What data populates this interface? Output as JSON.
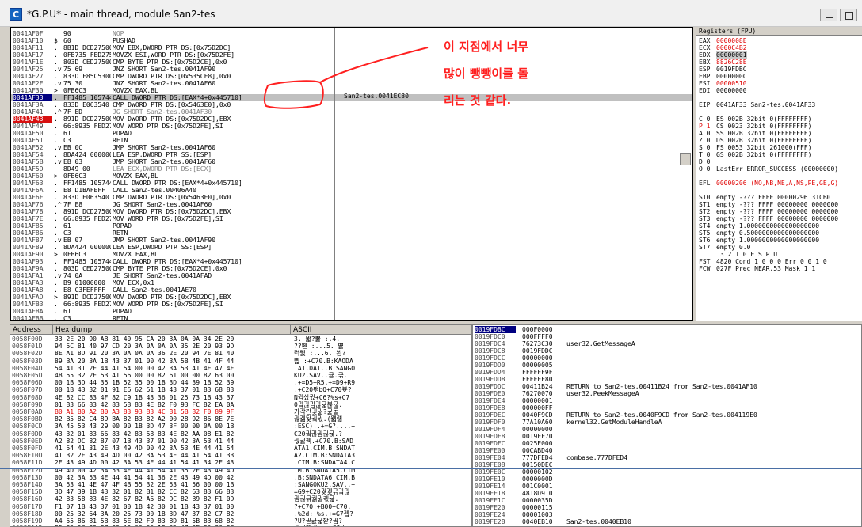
{
  "window": {
    "title": "*G.P.U* - main thread, module San2-tes",
    "app_icon_letter": "C"
  },
  "colors": {
    "annotation": "#ff2020",
    "breakpoint": "#d81010",
    "eip": "#000080",
    "selection": "#c0c0c0"
  },
  "disasm": {
    "rows": [
      {
        "addr": "0041AF0F",
        "mark": "",
        "hex": "90",
        "dis": "NOP",
        "style": "gray"
      },
      {
        "addr": "0041AF10",
        "mark": "$",
        "hex": "60",
        "dis": "PUSHAD",
        "style": ""
      },
      {
        "addr": "0041AF11",
        "mark": ".",
        "hex": "8B1D DCD27500",
        "dis": "MOV EBX,DWORD PTR DS:[0x75D2DC]",
        "style": ""
      },
      {
        "addr": "0041AF17",
        "mark": ".",
        "hex": "0FB735 FED275",
        "dis": "MOVZX ESI,WORD PTR DS:[0x75D2FE]",
        "style": ""
      },
      {
        "addr": "0041AF1E",
        "mark": ".",
        "hex": "803D CED27500",
        "dis": "CMP BYTE PTR DS:[0x75D2CE],0x0",
        "style": ""
      },
      {
        "addr": "0041AF25",
        "mark": ".v",
        "hex": "75 69",
        "dis": "JNZ SHORT San2-tes.0041AF90",
        "style": ""
      },
      {
        "addr": "0041AF27",
        "mark": ".",
        "hex": "833D F85C5300",
        "dis": "CMP DWORD PTR DS:[0x535CF8],0x0",
        "style": ""
      },
      {
        "addr": "0041AF2E",
        "mark": ".v",
        "hex": "75 30",
        "dis": "JNZ SHORT San2-tes.0041AF60",
        "style": ""
      },
      {
        "addr": "0041AF30",
        "mark": ">",
        "hex": "0FB6C3",
        "dis": "MOVZX EAX,BL",
        "style": ""
      },
      {
        "addr": "0041AF33",
        "mark": ".",
        "hex": "FF1485 105744",
        "dis": "CALL DWORD PTR DS:[EAX*4+0x445710]",
        "style": "eip sel"
      },
      {
        "addr": "0041AF3A",
        "mark": ".",
        "hex": "833D E063540",
        "dis": "CMP DWORD PTR DS:[0x5463E0],0x0",
        "style": ""
      },
      {
        "addr": "0041AF41",
        "mark": ".^",
        "hex": "7F ED",
        "dis": "JG SHORT San2-tes.0041AF30",
        "style": "gray"
      },
      {
        "addr": "0041AF43",
        "mark": ".",
        "hex": "891D DCD27500",
        "dis": "MOV DWORD PTR DS:[0x75D2DC],EBX",
        "style": "bp"
      },
      {
        "addr": "0041AF49",
        "mark": ".",
        "hex": "66:8935 FED27",
        "dis": "MOV WORD PTR DS:[0x75D2FE],SI",
        "style": ""
      },
      {
        "addr": "0041AF50",
        "mark": ".",
        "hex": "61",
        "dis": "POPAD",
        "style": ""
      },
      {
        "addr": "0041AF51",
        "mark": ".",
        "hex": "C3",
        "dis": "RETN",
        "style": ""
      },
      {
        "addr": "0041AF52",
        "mark": ".v",
        "hex": "EB 0C",
        "dis": "JMP SHORT San2-tes.0041AF60",
        "style": ""
      },
      {
        "addr": "0041AF54",
        "mark": ".",
        "hex": "8DA424 000000",
        "dis": "LEA ESP,DWORD PTR SS:[ESP]",
        "style": ""
      },
      {
        "addr": "0041AF5B",
        "mark": ".v",
        "hex": "EB 03",
        "dis": "JMP SHORT San2-tes.0041AF60",
        "style": ""
      },
      {
        "addr": "0041AF5D",
        "mark": "",
        "hex": "8D49 00",
        "dis": "LEA ECX,DWORD PTR DS:[ECX]",
        "style": "gray"
      },
      {
        "addr": "0041AF60",
        "mark": ">",
        "hex": "0FB6C3",
        "dis": "MOVZX EAX,BL",
        "style": ""
      },
      {
        "addr": "0041AF63",
        "mark": ".",
        "hex": "FF1485 105744",
        "dis": "CALL DWORD PTR DS:[EAX*4+0x445710]",
        "style": ""
      },
      {
        "addr": "0041AF6A",
        "mark": ".",
        "hex": "E8 D1BAFEFF",
        "dis": "CALL San2-tes.00406A40",
        "style": ""
      },
      {
        "addr": "0041AF6F",
        "mark": ".",
        "hex": "833D E063540",
        "dis": "CMP DWORD PTR DS:[0x5463E0],0x0",
        "style": ""
      },
      {
        "addr": "0041AF76",
        "mark": ".^",
        "hex": "7F E8",
        "dis": "JG SHORT San2-tes.0041AF60",
        "style": ""
      },
      {
        "addr": "0041AF78",
        "mark": ".",
        "hex": "891D DCD27500",
        "dis": "MOV DWORD PTR DS:[0x75D2DC],EBX",
        "style": ""
      },
      {
        "addr": "0041AF7E",
        "mark": ".",
        "hex": "66:8935 FED27",
        "dis": "MOV WORD PTR DS:[0x75D2FE],SI",
        "style": ""
      },
      {
        "addr": "0041AF85",
        "mark": ".",
        "hex": "61",
        "dis": "POPAD",
        "style": ""
      },
      {
        "addr": "0041AF86",
        "mark": ".",
        "hex": "C3",
        "dis": "RETN",
        "style": ""
      },
      {
        "addr": "0041AF87",
        "mark": ".v",
        "hex": "EB 07",
        "dis": "JMP SHORT San2-tes.0041AF90",
        "style": ""
      },
      {
        "addr": "0041AF89",
        "mark": ".",
        "hex": "8DA424 000000",
        "dis": "LEA ESP,DWORD PTR SS:[ESP]",
        "style": ""
      },
      {
        "addr": "0041AF90",
        "mark": ">",
        "hex": "0FB6C3",
        "dis": "MOVZX EAX,BL",
        "style": ""
      },
      {
        "addr": "0041AF93",
        "mark": ".",
        "hex": "FF1485 105744",
        "dis": "CALL DWORD PTR DS:[EAX*4+0x445710]",
        "style": ""
      },
      {
        "addr": "0041AF9A",
        "mark": ".",
        "hex": "803D CED27500",
        "dis": "CMP BYTE PTR DS:[0x75D2CE],0x0",
        "style": ""
      },
      {
        "addr": "0041AFA1",
        "mark": ".v",
        "hex": "74 0A",
        "dis": "JE SHORT San2-tes.0041AFAD",
        "style": ""
      },
      {
        "addr": "0041AFA3",
        "mark": ".",
        "hex": "B9 01000000",
        "dis": "MOV ECX,0x1",
        "style": ""
      },
      {
        "addr": "0041AFA8",
        "mark": ".",
        "hex": "E8 C3FEFFFF",
        "dis": "CALL San2-tes.0041AE70",
        "style": ""
      },
      {
        "addr": "0041AFAD",
        "mark": ">",
        "hex": "891D DCD27500",
        "dis": "MOV DWORD PTR DS:[0x75D2DC],EBX",
        "style": ""
      },
      {
        "addr": "0041AFB3",
        "mark": ".",
        "hex": "66:8935 FED27",
        "dis": "MOV WORD PTR DS:[0x75D2FE],SI",
        "style": ""
      },
      {
        "addr": "0041AFBA",
        "mark": ".",
        "hex": "61",
        "dis": "POPAD",
        "style": ""
      },
      {
        "addr": "0041AFBB",
        "mark": ".",
        "hex": "C3",
        "dis": "RETN",
        "style": ""
      }
    ],
    "info_text": "San2-tes.0041EC80"
  },
  "annotation": {
    "line1": "이 지점에서 너무",
    "line2": "많이 뺑뺑이를 돌",
    "line3": "리는 것 같다."
  },
  "registers": {
    "header": "Registers (FPU)",
    "lines": [
      {
        "k": "EAX",
        "v": "0000008E",
        "style": "red"
      },
      {
        "k": "ECX",
        "v": "0000C4B2",
        "style": "red"
      },
      {
        "k": "EDX",
        "v": "00000001",
        "style": "hl"
      },
      {
        "k": "EBX",
        "v": "8826C28E",
        "style": "red"
      },
      {
        "k": "ESP",
        "v": "0019FDBC",
        "style": ""
      },
      {
        "k": "EBP",
        "v": "0000000C",
        "style": ""
      },
      {
        "k": "ESI",
        "v": "00000510",
        "style": "red"
      },
      {
        "k": "EDI",
        "v": "00000000",
        "style": ""
      },
      {
        "k": "",
        "v": "",
        "style": ""
      },
      {
        "k": "EIP",
        "v": "0041AF33 San2-tes.0041AF33",
        "style": ""
      },
      {
        "k": "",
        "v": "",
        "style": ""
      },
      {
        "k": "C 0",
        "v": "ES 002B 32bit 0(FFFFFFFF)",
        "style": ""
      },
      {
        "k": "P 1",
        "v": "CS 0023 32bit 0(FFFFFFFF)",
        "style": "red"
      },
      {
        "k": "A 0",
        "v": "SS 002B 32bit 0(FFFFFFFF)",
        "style": ""
      },
      {
        "k": "Z 0",
        "v": "DS 002B 32bit 0(FFFFFFFF)",
        "style": ""
      },
      {
        "k": "S 0",
        "v": "FS 0053 32bit 261000(FFF)",
        "style": ""
      },
      {
        "k": "T 0",
        "v": "GS 002B 32bit 0(FFFFFFFF)",
        "style": ""
      },
      {
        "k": "D 0",
        "v": "",
        "style": ""
      },
      {
        "k": "O 0",
        "v": "LastErr ERROR_SUCCESS (00000000)",
        "style": ""
      },
      {
        "k": "",
        "v": "",
        "style": ""
      },
      {
        "k": "EFL",
        "v": "00000206 (NO,NB,NE,A,NS,PE,GE,G)",
        "style": "redv"
      },
      {
        "k": "",
        "v": "",
        "style": ""
      },
      {
        "k": "ST0",
        "v": "empty -??? FFFF 00000296 31CB0",
        "style": ""
      },
      {
        "k": "ST1",
        "v": "empty -??? FFFF 00000000 0000000",
        "style": ""
      },
      {
        "k": "ST2",
        "v": "empty -??? FFFF 00000000 0000000",
        "style": ""
      },
      {
        "k": "ST3",
        "v": "empty -??? FFFF 00000000 0000000",
        "style": ""
      },
      {
        "k": "ST4",
        "v": "empty 1.0000000000000000000",
        "style": ""
      },
      {
        "k": "ST5",
        "v": "empty 0.5000000000000000000",
        "style": ""
      },
      {
        "k": "ST6",
        "v": "empty 1.0000000000000000000",
        "style": ""
      },
      {
        "k": "ST7",
        "v": "empty 0.0",
        "style": ""
      },
      {
        "k": "",
        "v": "      3 2 1 0      E S P U",
        "style": ""
      },
      {
        "k": "FST",
        "v": "4820  Cond 1 0 0 0  Err 0 0 1 0",
        "style": ""
      },
      {
        "k": "FCW",
        "v": "027F  Prec NEAR,53  Mask    1 1",
        "style": ""
      }
    ]
  },
  "dump": {
    "headers": {
      "address": "Address",
      "hex": "Hex dump",
      "ascii": "ASCII"
    },
    "rows": [
      {
        "a": "0058F00D",
        "h": "33 2E 20 90 AB 81 40 95 CA 20 3A 0A 0A 34 2E 20",
        "s": "3. 뫏?뾽 :.4. "
      },
      {
        "a": "0058F01D",
        "h": "94 5C 81 40 97 CD 20 3A 0A 0A 0A 35 2E 20 93 9D",
        "s": "??뿬 :...5. 뱷"
      },
      {
        "a": "0058F02D",
        "h": "8E A1 8D 91 20 3A 0A 0A 0A 36 2E 20 94 7E 81 40",
        "s": "럭뛼 :...6. 뵘?"
      },
      {
        "a": "0058F03D",
        "h": "89 BA 20 3A 1B 43 37 01 00 42 3A 5B 4B 41 4F 44",
        "s": "쀫 :+C70.B:KAODA"
      },
      {
        "a": "0058F04D",
        "h": "54 41 31 2E 44 41 54 00 00 42 3A 53 41 4E 47 4F",
        "s": "TA1.DAT..B:SANGO"
      },
      {
        "a": "0058F05D",
        "h": "4B 55 32 2E 53 41 56 00 00 82 61 00 00 82 63 00",
        "s": "KU2.SAV..귬.귺."
      },
      {
        "a": "0058F06D",
        "h": "00 1B 3D 44 35 1B 52 35 00 1B 3D 44 39 1B 52 39",
        "s": ".+=D5+R5.+=D9+R9"
      },
      {
        "a": "0058F07D",
        "h": "00 1B 43 32 01 91 E6 62 51 1B 43 37 01 83 68 83",
        "s": ".+C20뫢bQ+C70븃?"
      },
      {
        "a": "0058F08D",
        "h": "4E 82 CC 83 4F 82 C9 1B 43 36 01 25 73 1B 43 37",
        "s": "N귁샀귔+C6?%s+C7"
      },
      {
        "a": "0058F09D",
        "h": "01 83 66 83 42 83 58 83 4E 82 F0 93 FC 82 EA 0A",
        "s": "0긬긚긤긚귩볺귢."
      },
      {
        "a": "0058F0AD",
        "h": "B0 A1 B0 A2 B0 A3 83 93 83 4C 81 5B 82 F0 89 9F",
        "s": "가각간긫긞?귩돟",
        "red": true
      },
      {
        "a": "0058F0BD",
        "h": "82 B5 82 C4 89 BA 82 B3 82 A2 00 28 92 86 8E 7E",
        "s": "귆궲돷궠궋.(뭷럚"
      },
      {
        "a": "0058F0CD",
        "h": "3A 45 53 43 29 00 00 1B 3D 47 3F 00 00 0A 00 1B",
        "s": ":ESC)..+=G?....+"
      },
      {
        "a": "0058F0DD",
        "h": "43 32 01 83 66 83 42 83 58 83 4E 82 AA 08 E1 82",
        "s": "C20긬긚긤긚귡.?"
      },
      {
        "a": "0058F0ED",
        "h": "A2 82 DC 82 B7 07 1B 43 37 01 00 42 3A 53 41 44",
        "s": "궋귏궥.+C70.B:SAD"
      },
      {
        "a": "0058F0FD",
        "h": "41 54 41 31 2E 43 49 4D 00 42 3A 53 4E 44 41 54",
        "s": "ATA1.CIM.B:SNDAT"
      },
      {
        "a": "0058F10D",
        "h": "41 32 2E 43 49 4D 00 42 3A 53 4E 44 41 54 41 33",
        "s": "A2.CIM.B:SNDATA3"
      },
      {
        "a": "0058F11D",
        "h": "2E 43 49 4D 00 42 3A 53 4E 44 41 54 41 34 2E 43",
        "s": ".CIM.B:SNDATA4.C"
      },
      {
        "a": "0058F12D",
        "h": "49 4D 00 42 3A 53 4E 44 41 54 41 35 2E 43 49 4D",
        "s": "IM.B:SNDATA5.CIM"
      },
      {
        "a": "0058F13D",
        "h": "00 42 3A 53 4E 44 41 54 41 36 2E 43 49 4D 00 42",
        "s": ".B:SNDATA6.CIM.B"
      },
      {
        "a": "0058F14D",
        "h": "3A 53 41 4E 47 4F 4B 55 32 2E 53 41 56 00 00 1B",
        "s": ":SANGOKU2.SAV..+"
      },
      {
        "a": "0058F15D",
        "h": "3D 47 39 1B 43 32 01 82 B1 82 CC 82 63 83 66 83",
        "s": "=G9+C20궞궻귺긬긚"
      },
      {
        "a": "0058F16D",
        "h": "42 83 58 83 4E 82 67 82 A6 82 DC 82 B9 82 F1 0D",
        "s": "긤긚귞궑귏궧귪."
      },
      {
        "a": "0058F17D",
        "h": "F1 07 1B 43 37 01 00 1B 42 30 01 1B 43 37 01 00",
        "s": "?+C70.+B00+C70."
      },
      {
        "a": "0058F18D",
        "h": "00 25 32 64 3A 20 25 73 00 1B 3D 47 37 82 C7 82",
        "s": ".%2d: %s.+=G7궵?"
      },
      {
        "a": "0058F19D",
        "h": "A4 55 86 81 5B 83 5E 82 F0 83 8D 81 5B 83 68 82",
        "s": "?U?긛긊귩깓?긤?"
      },
      {
        "a": "0058F1AD",
        "h": "B5 82 DC 82 B7 82 A9 00 00 1B 3D 47 3F 82 86 8E",
        "s": "궢귏궥궔..+=G?궞"
      }
    ]
  },
  "stack": {
    "rows": [
      {
        "a": "0019FDBC",
        "v": "000F0000",
        "c": ""
      },
      {
        "a": "0019FDC0",
        "v": "000FFFF0",
        "c": ""
      },
      {
        "a": "0019FDC4",
        "v": "76273C30",
        "c": "user32.GetMessageA"
      },
      {
        "a": "0019FDC8",
        "v": "0019FDDC",
        "c": ""
      },
      {
        "a": "0019FDCC",
        "v": "00000000",
        "c": ""
      },
      {
        "a": "0019FDD0",
        "v": "00000005",
        "c": ""
      },
      {
        "a": "0019FDD4",
        "v": "FFFFFF9F",
        "c": ""
      },
      {
        "a": "0019FDD8",
        "v": "FFFFFF80",
        "c": ""
      },
      {
        "a": "0019FDDC",
        "v": "00411B24",
        "c": "RETURN to San2-tes.00411B24 from San2-tes.0041AF10"
      },
      {
        "a": "0019FDE0",
        "v": "76270070",
        "c": "user32.PeekMessageA"
      },
      {
        "a": "0019FDE4",
        "v": "00000001",
        "c": ""
      },
      {
        "a": "0019FDE8",
        "v": "000000FF",
        "c": ""
      },
      {
        "a": "0019FDEC",
        "v": "0040F9CD",
        "c": "RETURN to San2-tes.0040F9CD from San2-tes.004119E0"
      },
      {
        "a": "0019FDF0",
        "v": "77A10A60",
        "c": "kernel32.GetModuleHandleA"
      },
      {
        "a": "0019FDF4",
        "v": "00000000",
        "c": ""
      },
      {
        "a": "0019FDF8",
        "v": "0019FF70",
        "c": ""
      },
      {
        "a": "0019FDFC",
        "v": "0025E000",
        "c": ""
      },
      {
        "a": "0019FE00",
        "v": "00CABD40",
        "c": ""
      },
      {
        "a": "0019FE04",
        "v": "777DFED4",
        "c": "combase.777DFED4"
      },
      {
        "a": "0019FE08",
        "v": "00150DEC",
        "c": ""
      },
      {
        "a": "0019FE0C",
        "v": "00000102",
        "c": ""
      },
      {
        "a": "0019FE10",
        "v": "0000000D",
        "c": ""
      },
      {
        "a": "0019FE14",
        "v": "001C0001",
        "c": ""
      },
      {
        "a": "0019FE18",
        "v": "4818D910",
        "c": ""
      },
      {
        "a": "0019FE1C",
        "v": "0000035D",
        "c": ""
      },
      {
        "a": "0019FE20",
        "v": "00000115",
        "c": ""
      },
      {
        "a": "0019FE24",
        "v": "00001003",
        "c": ""
      },
      {
        "a": "0019FE28",
        "v": "0040EB10",
        "c": "San2-tes.0040EB10"
      }
    ]
  }
}
